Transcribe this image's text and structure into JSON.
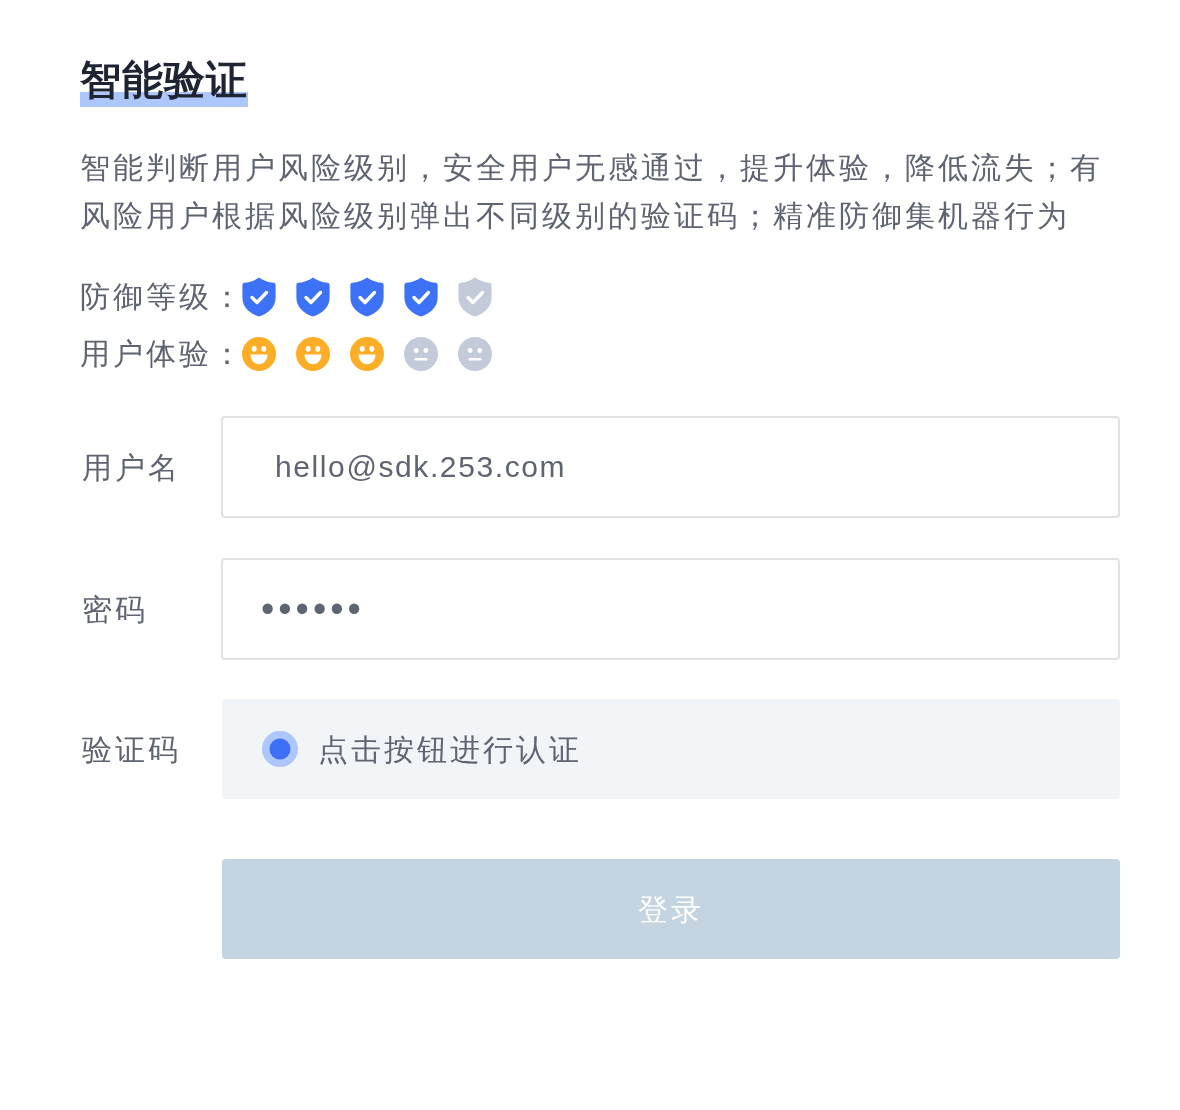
{
  "title": "智能验证",
  "description": "智能判断用户风险级别，安全用户无感通过，提升体验，降低流失；有风险用户根据风险级别弹出不同级别的验证码；精准防御集机器行为",
  "ratings": [
    {
      "kind": "shield",
      "label": "防御等级：",
      "icons": [
        {
          "active": true
        },
        {
          "active": true
        },
        {
          "active": true
        },
        {
          "active": true
        },
        {
          "active": false
        }
      ]
    },
    {
      "kind": "face",
      "label": "用户体验：",
      "icons": [
        {
          "active": true
        },
        {
          "active": true
        },
        {
          "active": true
        },
        {
          "active": false
        },
        {
          "active": false
        }
      ]
    }
  ],
  "fields": [
    {
      "kind": "text",
      "label": "用户名",
      "value": "hello@sdk.253.com"
    },
    {
      "kind": "password",
      "label": "密码",
      "value": "••••••"
    }
  ],
  "captcha": {
    "label": "验证码",
    "text": "点击按钮进行认证"
  },
  "login_button": {
    "label": "登录",
    "disabled": true
  }
}
